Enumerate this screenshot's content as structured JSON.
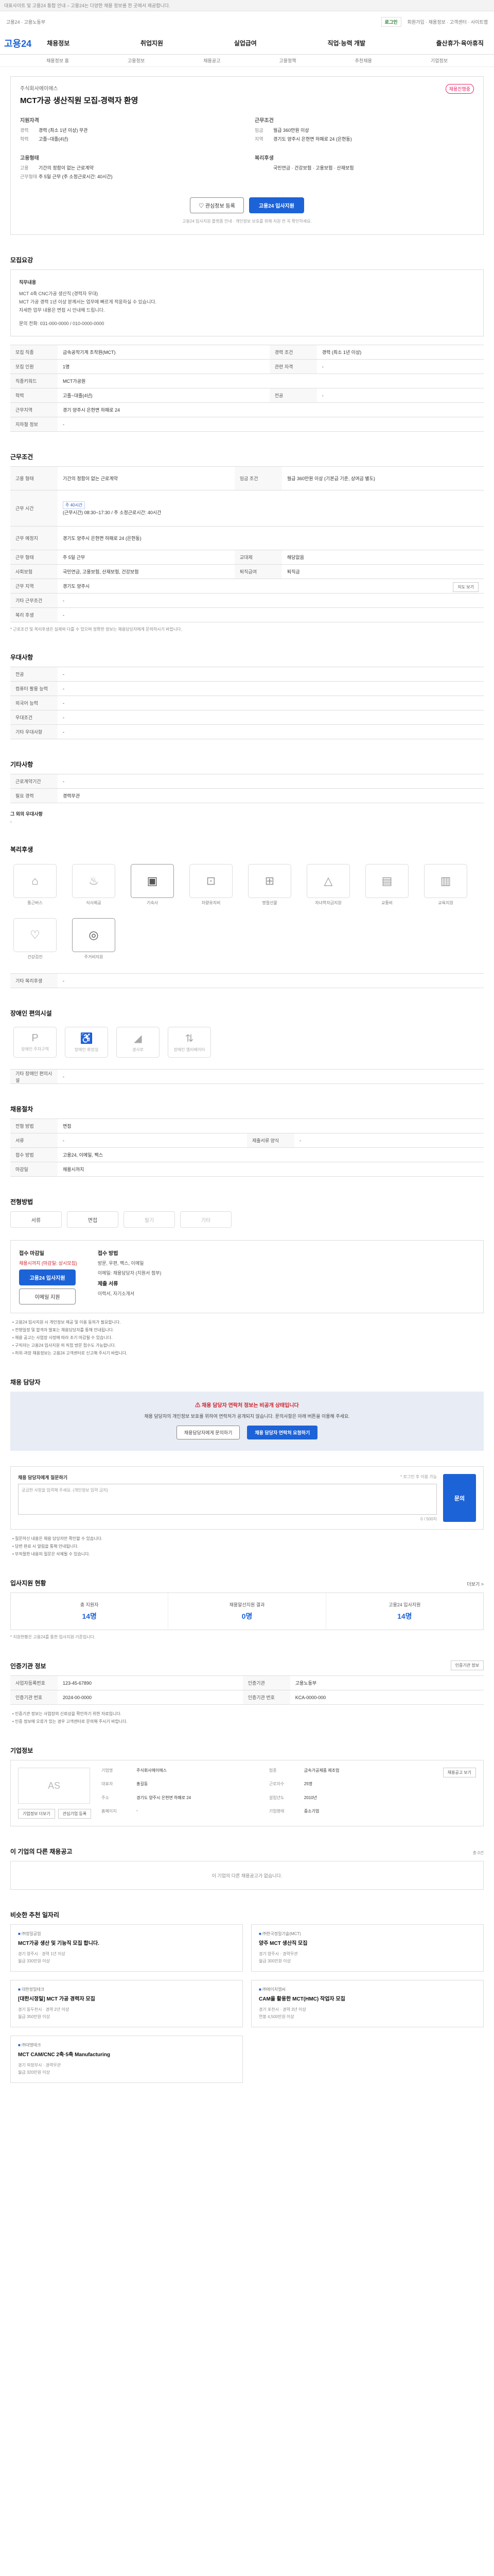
{
  "topbar": {
    "text": "대표사이트 및 고용24 통합 안내 – 고용24는 다양한 채용 정보를 한 곳에서 제공합니다."
  },
  "util": {
    "left": "고용24 · 고용노동부",
    "step": "로그인",
    "right": "회원가입 · 채용정보 · 고객센터 · 사이트맵"
  },
  "header": {
    "logo": "고용24",
    "nav": [
      "채용정보",
      "취업지원",
      "실업급여",
      "직업·능력 개발",
      "출산휴가·육아휴직"
    ]
  },
  "subnav": [
    "채용정보 홈",
    "고용정보",
    "채용공고",
    "고용정책",
    "추천채용",
    "기업정보"
  ],
  "hero": {
    "company": "주식회사에이에스",
    "title": "MCT가공 생산직원 모집-경력자 환영",
    "badge": "채용진행중",
    "groups": [
      {
        "h": "지원자격",
        "rows": [
          {
            "k": "경력",
            "v": "경력 (최소 1년 이상) 무관"
          },
          {
            "k": "학력",
            "v": "고졸~대졸(4년)"
          }
        ]
      },
      {
        "h": "근무조건",
        "rows": [
          {
            "k": "임금",
            "v": "월급 360만원 이상"
          },
          {
            "k": "지역",
            "v": "경기도 양주시 은현면 하패로 24 (은현동)"
          }
        ]
      },
      {
        "h": "고용형태",
        "rows": [
          {
            "k": "고용",
            "v": "기간의 정함이 없는 근로계약"
          },
          {
            "k": "근무형태",
            "v": "주 5일 근무 (주 소정근로시간: 40시간)"
          }
        ]
      },
      {
        "h": "복리후생",
        "rows": [
          {
            "k": "",
            "v": "국민연금 · 건강보험 · 고용보험 · 산재보험"
          }
        ]
      }
    ],
    "save_btn": "관심정보 등록",
    "apply_btn": "고용24 입사지원",
    "note": "고용24 입사지원 플랫폼 안내 · 개인정보 보호를 위해 지원 전 꼭 확인하세요."
  },
  "recruit": {
    "h": "모집요강",
    "box_title": "직무내용",
    "box_lines": [
      "MCT 4축 CNC가공 생산직 (경력자 우대)",
      "MCT 가공 경력 1년 이상 분께서는 업무에 빠르게 적응하실 수 있습니다.",
      "자세한 업무 내용은 면접 시 안내해 드립니다.",
      "문의 전화: 031-000-0000 / 010-0000-0000"
    ],
    "rows": [
      {
        "k": "모집 직종",
        "v": "금속공작기계 조작원(MCT)",
        "k2": "경력 조건",
        "v2": "경력 (최소 1년 이상)"
      },
      {
        "k": "모집 인원",
        "v": "1명",
        "k2": "관련 자격",
        "v2": "-"
      },
      {
        "k": "직종키워드",
        "v": "MCT가공원",
        "k2": "",
        "v2": ""
      },
      {
        "k": "학력",
        "v": "고졸~대졸(4년)",
        "k2": "전공",
        "v2": "-"
      },
      {
        "k": "근무지역",
        "v": "경기 양주시 은현면 하패로 24",
        "k2": "",
        "v2": ""
      },
      {
        "k": "지하철 정보",
        "v": "-",
        "k2": "",
        "v2": ""
      }
    ]
  },
  "conditions": {
    "h": "근무조건",
    "row1": {
      "k": "고용 형태",
      "v": "기간의 정함이 없는 근로계약",
      "k2": "임금 조건",
      "v2": "월급 360만원 이상 (기본급 기준, 상여금 별도)"
    },
    "row2": {
      "k": "근무 시간",
      "v": "(근무시간) 08:30~17:30 / 주 소정근로시간: 40시간",
      "tag": "주 40시간"
    },
    "row3": {
      "k": "근무 예정지",
      "v": "경기도 양주시 은현면 하패로 24 (은현동)",
      "k2": "",
      "v2": ""
    },
    "row4": {
      "k": "근무 형태",
      "v": "주 5일 근무",
      "k2": "교대제",
      "v2": "해당없음"
    },
    "row5": {
      "k": "사회보험",
      "v": "국민연금, 고용보험, 산재보험, 건강보험",
      "k2": "퇴직급여",
      "v2": "퇴직금"
    },
    "row6": {
      "k": "근무 지역",
      "v": "경기도 양주시",
      "btn": "지도 보기"
    },
    "row7": {
      "k": "기타 근무조건",
      "v": "-"
    },
    "row8": {
      "k": "복리 후생",
      "v": "-"
    },
    "note": "* 근로조건 및 복리후생은 실제와 다를 수 있으며 정확한 정보는 채용담당자에게 문의하시기 바랍니다."
  },
  "prefer": {
    "h": "우대사항",
    "rows": [
      {
        "k": "전공",
        "v": "-"
      },
      {
        "k": "컴퓨터 활용 능력",
        "v": "-"
      },
      {
        "k": "외국어 능력",
        "v": "-"
      },
      {
        "k": "우대조건",
        "v": "-"
      },
      {
        "k": "기타 우대사항",
        "v": "-"
      }
    ]
  },
  "etc": {
    "h": "기타사항",
    "rows": [
      {
        "k": "근로계약기간",
        "v": "-"
      },
      {
        "k": "필요 경력",
        "v": "경력무관"
      }
    ],
    "more_h": "그 외의 우대사항",
    "more_v": "-"
  },
  "welfare": {
    "h": "복리후생",
    "items": [
      {
        "icon": "house-icon",
        "label": "통근버스",
        "on": false
      },
      {
        "icon": "meal-icon",
        "label": "식사제공",
        "on": false
      },
      {
        "icon": "dorm-icon",
        "label": "기숙사",
        "on": true
      },
      {
        "icon": "car-icon",
        "label": "차량유지비",
        "on": false
      },
      {
        "icon": "gift-icon",
        "label": "명절선물",
        "on": false
      },
      {
        "icon": "cap-icon",
        "label": "자녀학자금지원",
        "on": false
      },
      {
        "icon": "bus-icon",
        "label": "교통비",
        "on": false
      },
      {
        "icon": "book-icon",
        "label": "교육지원",
        "on": false
      },
      {
        "icon": "heart-icon",
        "label": "건강검진",
        "on": false
      },
      {
        "icon": "support-icon",
        "label": "주거비지원",
        "on": true
      }
    ],
    "other_k": "기타 복리후생",
    "other_v": "-"
  },
  "disability": {
    "h": "장애인 편의시설",
    "items": [
      {
        "label": "장애인 주차구역"
      },
      {
        "label": "장애인 화장실"
      },
      {
        "label": "경사로"
      },
      {
        "label": "장애인 엘리베이터"
      }
    ],
    "other_k": "기타 장애인 편의시설",
    "other_v": "-"
  },
  "process": {
    "h": "채용절차",
    "rows": [
      {
        "k": "전형 방법",
        "v": "면접",
        "k2": "",
        "v2": ""
      },
      {
        "k": "서류",
        "v": "-",
        "k2": "제출서류 양식",
        "v2": "-"
      },
      {
        "k": "접수 방법",
        "v": "고용24, 이메일, 팩스",
        "k2": "",
        "v2": ""
      },
      {
        "k": "마감일",
        "v": "채용시까지",
        "k2": "",
        "v2": ""
      }
    ]
  },
  "apply_method": {
    "h": "전형방법",
    "chips": [
      {
        "label": "서류",
        "off": false
      },
      {
        "label": "면접",
        "off": false
      },
      {
        "label": "필기",
        "off": true
      },
      {
        "label": "기타",
        "off": true
      }
    ],
    "col1_h": "접수 마감일",
    "col1_lines": [
      "채용시까지 (마감일: 상시모집)"
    ],
    "col1_btn1": "고용24 입사지원",
    "col1_btn2": "이메일 지원",
    "col2_h": "접수 방법",
    "col2_lines": [
      "방문, 우편, 팩스, 이메일",
      "이메일: 채용담당자 (지원서 첨부)",
      "제출 서류",
      "이력서, 자기소개서"
    ],
    "notes": [
      "• 고용24 입사지원 시 개인정보 제공 및 이용 동의가 필요합니다.",
      "• 전형일정 및 합격자 발표는 채용담당자를 통해 안내됩니다.",
      "• 채용 공고는 사업장 사정에 따라 조기 마감될 수 있습니다.",
      "• 구직자는 고용24 입사지원 외 직접 방문 접수도 가능합니다.",
      "• 허위·과장 채용정보는 고용24 고객센터로 신고해 주시기 바랍니다."
    ]
  },
  "contact": {
    "h": "채용 담당자",
    "banner_title": "채용 담당자 연락처 정보는 비공개 상태입니다",
    "banner_text": "채용 담당자의 개인정보 보호를 위하여 연락처가 공개되지 않습니다. 문의사항은 아래 버튼을 이용해 주세요.",
    "btn1": "채용담당자에게 문의하기",
    "btn2": "채용 담당자 연락처 요청하기"
  },
  "question": {
    "label": "채용 담당자에게 질문하기",
    "hint": "* 로그인 후 이용 가능",
    "placeholder": "궁금한 사항을 입력해 주세요. (개인정보 입력 금지)",
    "count": "0 / 500자",
    "submit": "문의",
    "notes": [
      "• 질문하신 내용은 채용 담당자만 확인할 수 있습니다.",
      "• 답변 완료 시 알림을 통해 안내됩니다.",
      "• 부적절한 내용의 질문은 삭제될 수 있습니다."
    ]
  },
  "stats": {
    "h": "입사지원 현황",
    "more": "더보기 >",
    "items": [
      {
        "label": "총 지원자",
        "value": "14명"
      },
      {
        "label": "채용알선지원 결과",
        "value": "0명"
      },
      {
        "label": "고용24 입사지원",
        "value": "14명"
      }
    ],
    "note": "* 지원현황은 고용24를 통한 입사지원 기준입니다."
  },
  "info": {
    "h": "인증기관 정보",
    "btn": "인증기관 정보",
    "rows": [
      {
        "k": "사업자등록번호",
        "v": "123-45-67890",
        "k2": "인증기관",
        "v2": "고용노동부"
      },
      {
        "k": "인증기관 번호",
        "v": "2024-00-0000",
        "k2": "인증기관 번호",
        "v2": "KCA-0000-000"
      }
    ],
    "notes": [
      "• 인증기관 정보는 사업장의 신뢰성을 확인하기 위한 자료입니다.",
      "• 인증 정보에 오류가 있는 경우 고객센터로 문의해 주시기 바랍니다."
    ]
  },
  "company": {
    "h": "기업정보",
    "logo": "AS",
    "rows": [
      {
        "k": "기업명",
        "v": "주식회사에이에스",
        "k2": "업종",
        "v2": "금속가공제품 제조업"
      },
      {
        "k": "대표자",
        "v": "홍길동",
        "k2": "근로자수",
        "v2": "25명"
      },
      {
        "k": "주소",
        "v": "경기도 양주시 은현면 하패로 24",
        "k2": "설립년도",
        "v2": "2010년"
      },
      {
        "k": "홈페이지",
        "v": "-",
        "k2": "기업형태",
        "v2": "중소기업"
      }
    ],
    "btn1": "기업정보 더보기",
    "btn2": "관심기업 등록",
    "btn3": "채용공고 보기"
  },
  "other_jobs": {
    "h": "이 기업의 다른 채용공고",
    "sub": "총 0건",
    "empty": "이 기업의 다른 채용공고가 없습니다."
  },
  "recommend": {
    "h": "비슷한 추천 일자리",
    "cards": [
      {
        "co": "㈜정밀공업",
        "title": "MCT가공 생산 및 기능직 모집 합니다.",
        "meta1": "경기 양주시 · 경력 1년 이상",
        "meta2": "월급 330만원 이상"
      },
      {
        "co": "㈜한국정밀기술(MCT)",
        "title": "양주 MCT 생산직 모집",
        "meta1": "경기 양주시 · 경력무관",
        "meta2": "월급 300만원 이상"
      },
      {
        "co": "대한정밀테크",
        "title": "[대한시정밀] MCT 가공 경력자 모집",
        "meta1": "경기 동두천시 · 경력 2년 이상",
        "meta2": "월급 350만원 이상"
      },
      {
        "co": "㈜에이치엠씨",
        "title": "CAM을 활용한 MCT(HMC) 작업자 모집",
        "meta1": "경기 포천시 · 경력 3년 이상",
        "meta2": "연봉 4,500만원 이상"
      },
      {
        "co": "㈜대명테크",
        "title": "MCT CAM/CNC 2축·5축 Manufacturing",
        "meta1": "경기 의정부시 · 경력무관",
        "meta2": "월급 320만원 이상"
      }
    ]
  }
}
